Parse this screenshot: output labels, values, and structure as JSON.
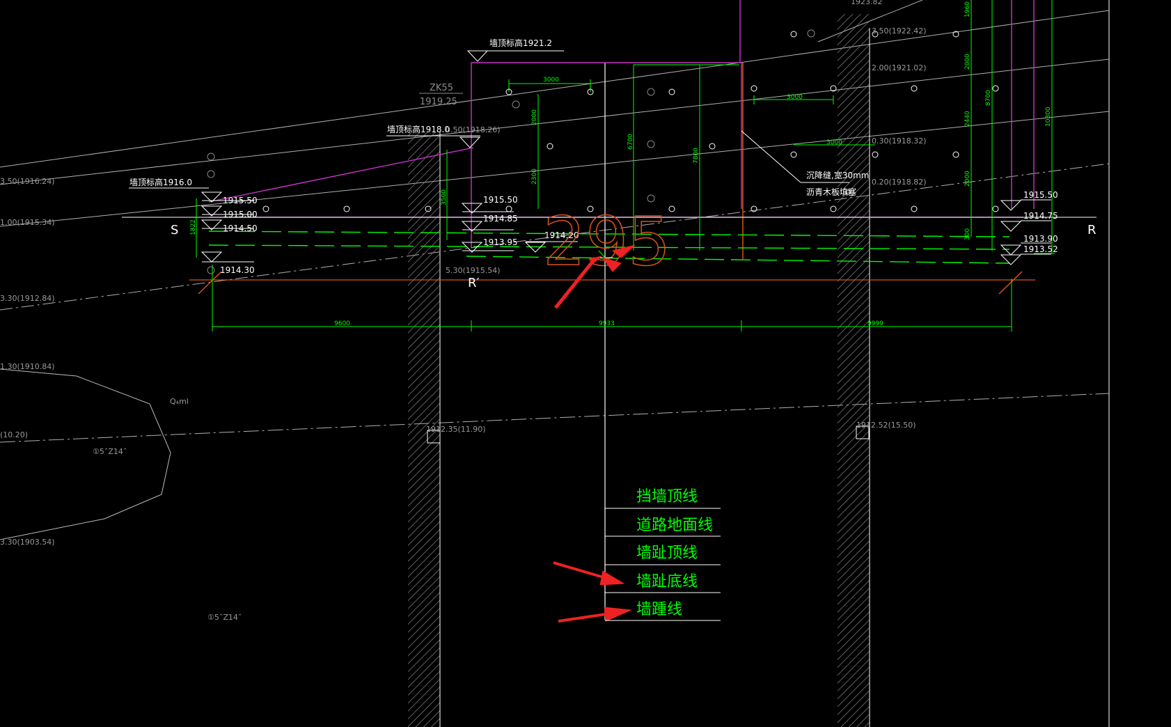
{
  "drawing": {
    "section_labels": {
      "left": "S",
      "right": "R",
      "bottom": "R′"
    },
    "borehole": {
      "name": "ZK55",
      "elevation": "1919.25"
    },
    "wall_top_labels": [
      "墙顶标高1921.2",
      "墙顶标高1918.0",
      "墙顶标高1916.0"
    ],
    "left_elevations": [
      "1915.50",
      "1915.00",
      "1914.50",
      "1914.30"
    ],
    "mid_elevations": [
      "1915.50",
      "1914.85",
      "1913.95",
      "1914.20"
    ],
    "right_elevations": [
      "1915.50",
      "1914.75",
      "1913.90",
      "1913.52"
    ],
    "bottom_dimensions": [
      "9600",
      "9933",
      "9999"
    ],
    "grid_dimensions": [
      "3000",
      "3000",
      "3000"
    ],
    "vertical_dimensions": [
      "2000",
      "2300",
      "6700",
      "7800",
      "3500",
      "1822",
      "1960",
      "2000",
      "2440",
      "2000",
      "8700",
      "10300",
      "300"
    ],
    "notes": [
      "沉降缝,宽30mm",
      "沥青木板填塞"
    ],
    "annotation_number": "295",
    "pile_labels": [
      "1912.35(11.90)",
      "1912.52(15.50)"
    ],
    "misc_labels": [
      "1923.82",
      "3.50(1922.42)",
      "2.00(1921.02)",
      "0.50(1918.26)",
      "0.30(1918.32)",
      "0.20(1918.82)",
      "3.50(1916.24)",
      "1.00(1915.34)",
      "5.30(1915.54)",
      "3.30(1912.84)",
      "1.30(1910.84)",
      "(10.20)",
      "3.30(1903.54)",
      "Q₄ml",
      "①5ˆZ14ˆ",
      "①5ˆZ14ˆ"
    ]
  },
  "legend": {
    "items": [
      "挡墙顶线",
      "道路地面线",
      "墙趾顶线",
      "墙趾底线",
      "墙踵线"
    ]
  },
  "colors": {
    "background": "#000000",
    "dim_green": "#00ff00",
    "magenta": "#cc33cc",
    "orange": "#d9531e",
    "red_arrow": "#ee2222",
    "white_line": "#ffffff",
    "grey_line": "#9a9a9a"
  }
}
